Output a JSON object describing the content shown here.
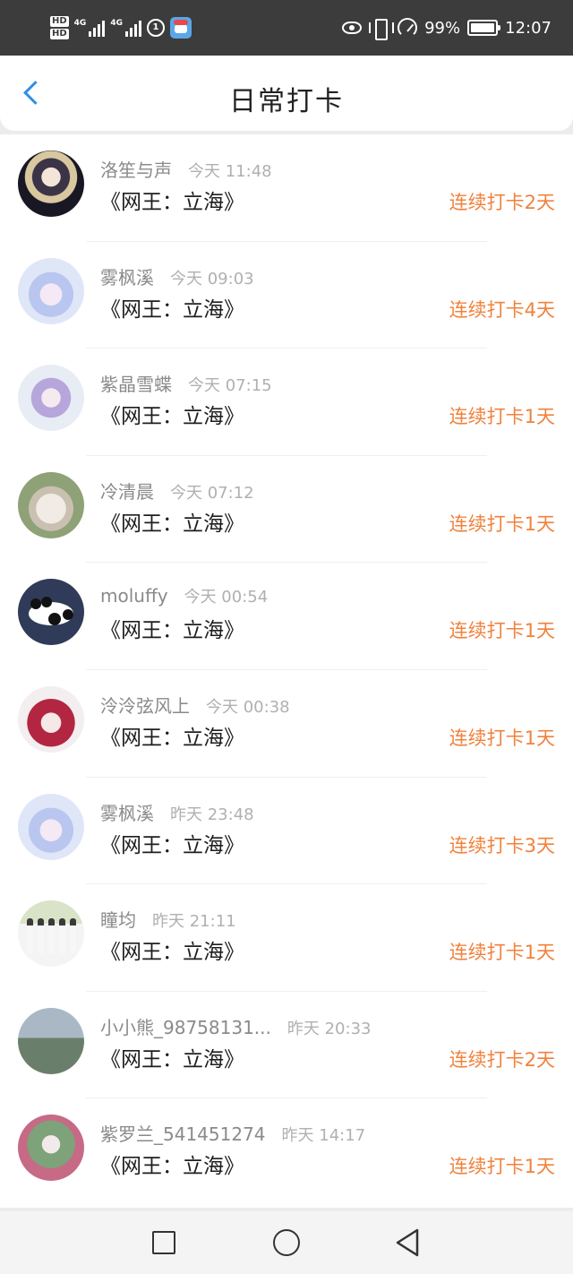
{
  "status_bar": {
    "sim1": "HD",
    "sim2": "HD",
    "network1": "4G",
    "network2": "4G",
    "battery": "99%",
    "time": "12:07",
    "icons": [
      "eye-icon",
      "vibrate-icon",
      "speed-icon",
      "battery-icon"
    ]
  },
  "header": {
    "title": "日常打卡",
    "back_icon": "chevron-left-icon",
    "accent_color": "#2d8ee6"
  },
  "streak_color": "#f0823c",
  "checkins": [
    {
      "user": "洛笙与声",
      "time": "今天 11:48",
      "book": "《网王：立海》",
      "streak": "连续打卡2天"
    },
    {
      "user": "雾枫溪",
      "time": "今天 09:03",
      "book": "《网王：立海》",
      "streak": "连续打卡4天"
    },
    {
      "user": "紫晶雪蝶",
      "time": "今天 07:15",
      "book": "《网王：立海》",
      "streak": "连续打卡1天"
    },
    {
      "user": "冷清晨",
      "time": "今天 07:12",
      "book": "《网王：立海》",
      "streak": "连续打卡1天"
    },
    {
      "user": "moluffy",
      "time": "今天 00:54",
      "book": "《网王：立海》",
      "streak": "连续打卡1天"
    },
    {
      "user": "泠泠弦风上",
      "time": "今天 00:38",
      "book": "《网王：立海》",
      "streak": "连续打卡1天"
    },
    {
      "user": "雾枫溪",
      "time": "昨天 23:48",
      "book": "《网王：立海》",
      "streak": "连续打卡3天"
    },
    {
      "user": "瞳均",
      "time": "昨天 21:11",
      "book": "《网王：立海》",
      "streak": "连续打卡1天"
    },
    {
      "user": "小小熊_98758131...",
      "time": "昨天 20:33",
      "book": "《网王：立海》",
      "streak": "连续打卡2天"
    },
    {
      "user": "紫罗兰_541451274",
      "time": "昨天 14:17",
      "book": "《网王：立海》",
      "streak": "连续打卡1天"
    }
  ],
  "nav": {
    "icons": [
      "recents-square-icon",
      "home-circle-icon",
      "back-triangle-icon"
    ]
  }
}
